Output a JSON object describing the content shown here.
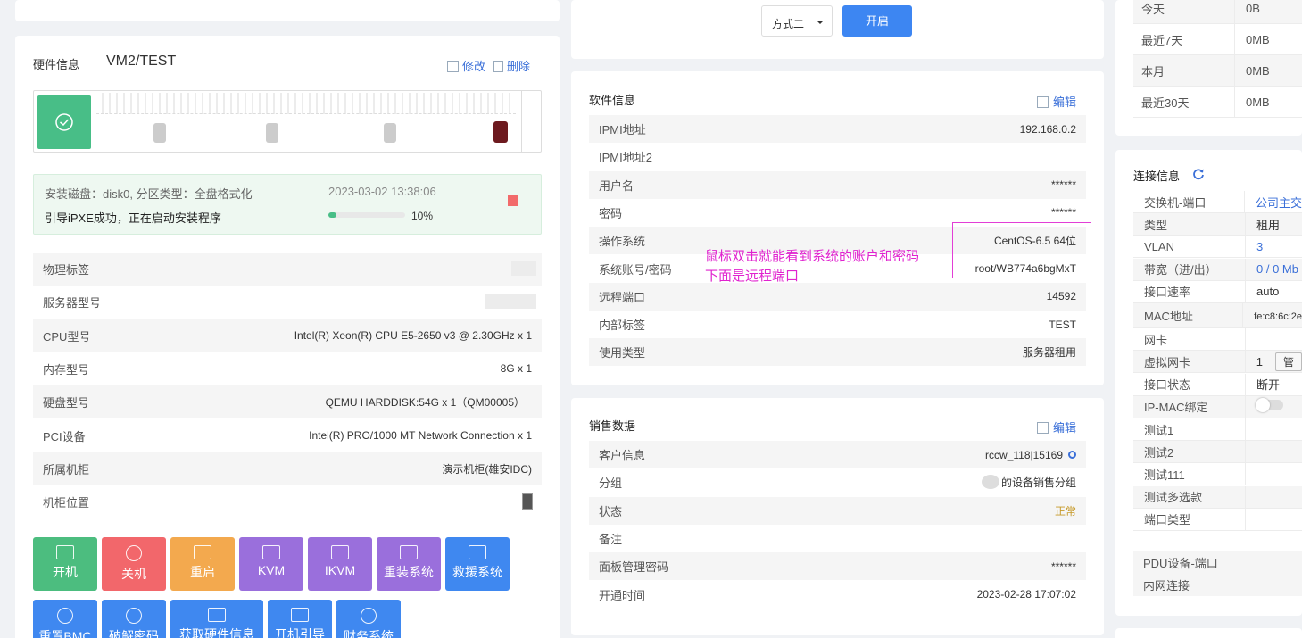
{
  "hardware": {
    "title": "硬件信息",
    "name": "VM2/TEST",
    "edit": "修改",
    "delete": "删除",
    "install": {
      "disk_line": "安装磁盘：disk0, 分区类型：全盘格式化",
      "time": "2023-03-02 13:38:06",
      "status": "引导iPXE成功，正在启动安装程序",
      "progress_text": "10%",
      "progress": 0.1
    },
    "rows": [
      {
        "k": "物理标签",
        "v": ""
      },
      {
        "k": "服务器型号",
        "v": ""
      },
      {
        "k": "CPU型号",
        "v": "Intel(R) Xeon(R) CPU E5-2650 v3 @ 2.30GHz x 1"
      },
      {
        "k": "内存型号",
        "v": "8G x 1"
      },
      {
        "k": "硬盘型号",
        "v": "QEMU HARDDISK:54G x 1（QM00005）"
      },
      {
        "k": "PCI设备",
        "v": "Intel(R) PRO/1000 MT Network Connection x 1"
      },
      {
        "k": "所属机柜",
        "v": "演示机柜(雄安IDC)"
      },
      {
        "k": "机柜位置",
        "v": ""
      }
    ],
    "buttons": [
      {
        "label": "开机",
        "color": "#4cbd7f",
        "icon": "power-monitor-icon"
      },
      {
        "label": "关机",
        "color": "#f2676b",
        "icon": "power-icon"
      },
      {
        "label": "重启",
        "color": "#f3a94e",
        "icon": "loading-icon"
      },
      {
        "label": "KVM",
        "color": "#9a6fdc",
        "icon": "kvm-icon"
      },
      {
        "label": "IKVM",
        "color": "#9a6fdc",
        "icon": "keyboard-icon"
      },
      {
        "label": "重装系统",
        "color": "#9a6fdc",
        "icon": "monitor-icon"
      },
      {
        "label": "救援系统",
        "color": "#3f88f0",
        "icon": "wrench-icon"
      },
      {
        "label": "重置BMC",
        "color": "#3f88f0",
        "icon": "reset-icon"
      },
      {
        "label": "破解密码",
        "color": "#3f88f0",
        "icon": "key-icon"
      },
      {
        "label": "获取硬件信息",
        "color": "#3f88f0",
        "icon": "hardware-icon"
      },
      {
        "label": "开机引导",
        "color": "#3f88f0",
        "icon": "boot-icon"
      },
      {
        "label": "财务系统",
        "color": "#3f88f0",
        "icon": "settings-icon"
      }
    ]
  },
  "top_center": {
    "select_value": "方式二",
    "start_label": "开启"
  },
  "software": {
    "title": "软件信息",
    "edit": "编辑",
    "rows": [
      {
        "k": "IPMI地址",
        "v": "192.168.0.2",
        "link": true
      },
      {
        "k": "IPMI地址2",
        "v": ""
      },
      {
        "k": "用户名",
        "v": "******"
      },
      {
        "k": "密码",
        "v": "******"
      },
      {
        "k": "操作系统",
        "v": "CentOS-6.5 64位"
      },
      {
        "k": "系统账号/密码",
        "v": "root/WB774a6bgMxT"
      },
      {
        "k": "远程端口",
        "v": "14592"
      },
      {
        "k": "内部标签",
        "v": "TEST"
      },
      {
        "k": "使用类型",
        "v": "服务器租用"
      }
    ],
    "annotation_line1": "鼠标双击就能看到系统的账户和密码",
    "annotation_line2": "下面是远程端口"
  },
  "sales": {
    "title": "销售数据",
    "edit": "编辑",
    "rows": [
      {
        "k": "客户信息",
        "v": "rccw_118|15169"
      },
      {
        "k": "分组",
        "v": "的设备销售分组"
      },
      {
        "k": "状态",
        "v": "正常"
      },
      {
        "k": "备注",
        "v": ""
      },
      {
        "k": "面板管理密码",
        "v": "******"
      },
      {
        "k": "开通时间",
        "v": "2023-02-28 17:07:02"
      }
    ]
  },
  "traffic": {
    "rows": [
      {
        "k": "今天",
        "v": "0B"
      },
      {
        "k": "最近7天",
        "v": "0MB"
      },
      {
        "k": "本月",
        "v": "0MB"
      },
      {
        "k": "最近30天",
        "v": "0MB"
      }
    ]
  },
  "connection": {
    "title": "连接信息",
    "rows": [
      {
        "k": "交换机-端口",
        "v": "公司主交"
      },
      {
        "k": "类型",
        "v": "租用"
      },
      {
        "k": "VLAN",
        "v": "3"
      },
      {
        "k": "带宽（进/出）",
        "v": "0 / 0 Mb"
      },
      {
        "k": "接口速率",
        "v": "auto"
      },
      {
        "k": "MAC地址",
        "v": "fe:c8:6c:2e"
      },
      {
        "k": "网卡",
        "v": ""
      },
      {
        "k": "虚拟网卡",
        "v": "1"
      },
      {
        "k": "接口状态",
        "v": "断开"
      },
      {
        "k": "IP-MAC绑定",
        "v": ""
      },
      {
        "k": "测试1",
        "v": ""
      },
      {
        "k": "测试2",
        "v": ""
      },
      {
        "k": "测试111",
        "v": ""
      },
      {
        "k": "测试多选款",
        "v": ""
      },
      {
        "k": "端口类型",
        "v": ""
      }
    ],
    "manage_label": "管",
    "pdu_label": "PDU设备-端口",
    "intranet_label": "内网连接"
  }
}
